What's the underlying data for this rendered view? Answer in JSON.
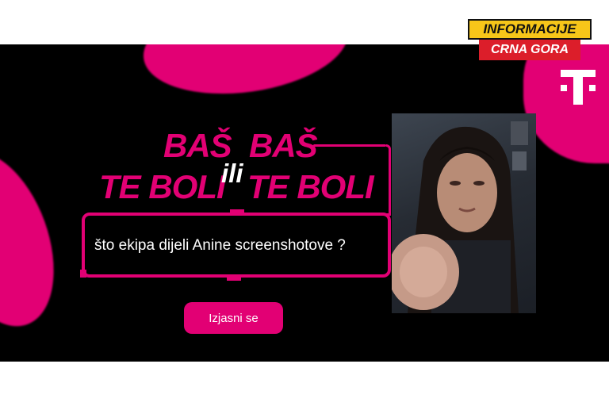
{
  "ad": {
    "headline_line1_left": "BAŠ",
    "headline_line2_left": "TE BOLI",
    "headline_connector": "ili",
    "headline_line1_right": "BAŠ",
    "headline_line2_right": "TE BOLI",
    "question": "što ekipa dijeli Anine screenshotove ?",
    "cta_label": "Izjasni se",
    "brand_logo": "telekom-t-logo",
    "accent_color": "#e20074"
  },
  "badge": {
    "top_label": "INFORMACIJE",
    "bottom_label": "CRNA GORA",
    "top_color": "#f7c619",
    "bottom_color": "#dc1e2a"
  }
}
